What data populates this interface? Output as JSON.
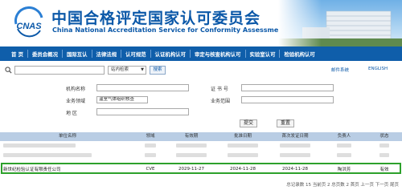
{
  "header": {
    "logo_text": "CNAS",
    "org_name_cn": "中国合格评定国家认可委员会",
    "org_name_en": "China National Accreditation Service for Conformity Assessment"
  },
  "nav": {
    "items": [
      "首 页",
      "委员会概况",
      "国际互认",
      "法律法规",
      "认可规范",
      "认证机构认可",
      "审定与核查机构认可",
      "实验室认可",
      "检验机构认可"
    ]
  },
  "search": {
    "select_value": "站内检索",
    "button_label": "搜索",
    "link_mail": "邮件系统",
    "link_english": "ENGLISH"
  },
  "form": {
    "org_name_label": "机构名称",
    "cert_no_label": "证 书 号",
    "business_field_label": "业务领域",
    "business_field_value": "温室气体组织核查",
    "business_scope_label": "业务范围",
    "region_label": "地 区",
    "submit_label": "提交",
    "reset_label": "重置"
  },
  "table": {
    "headers": [
      "单位名称",
      "领域",
      "有效期",
      "批准日期",
      "首次发证日期",
      "负责人",
      "状态"
    ],
    "highlighted_row": {
      "name": "新世纪检验认证有限责任公司",
      "field": "CVE",
      "valid_until": "2029-11-27",
      "approved": "2024-11-28",
      "first_issued": "2024-11-28",
      "person": "陶洪芳",
      "status": "有效"
    }
  },
  "pagination": {
    "text": "总记录数 15 当前页 2 总页数 2 首页 上一页 下一页 尾页"
  },
  "colors": {
    "brand_blue": "#0b58a8",
    "nav_blue": "#0f5eaa",
    "table_header": "#b9cde4",
    "highlight_green": "#2da12b"
  }
}
